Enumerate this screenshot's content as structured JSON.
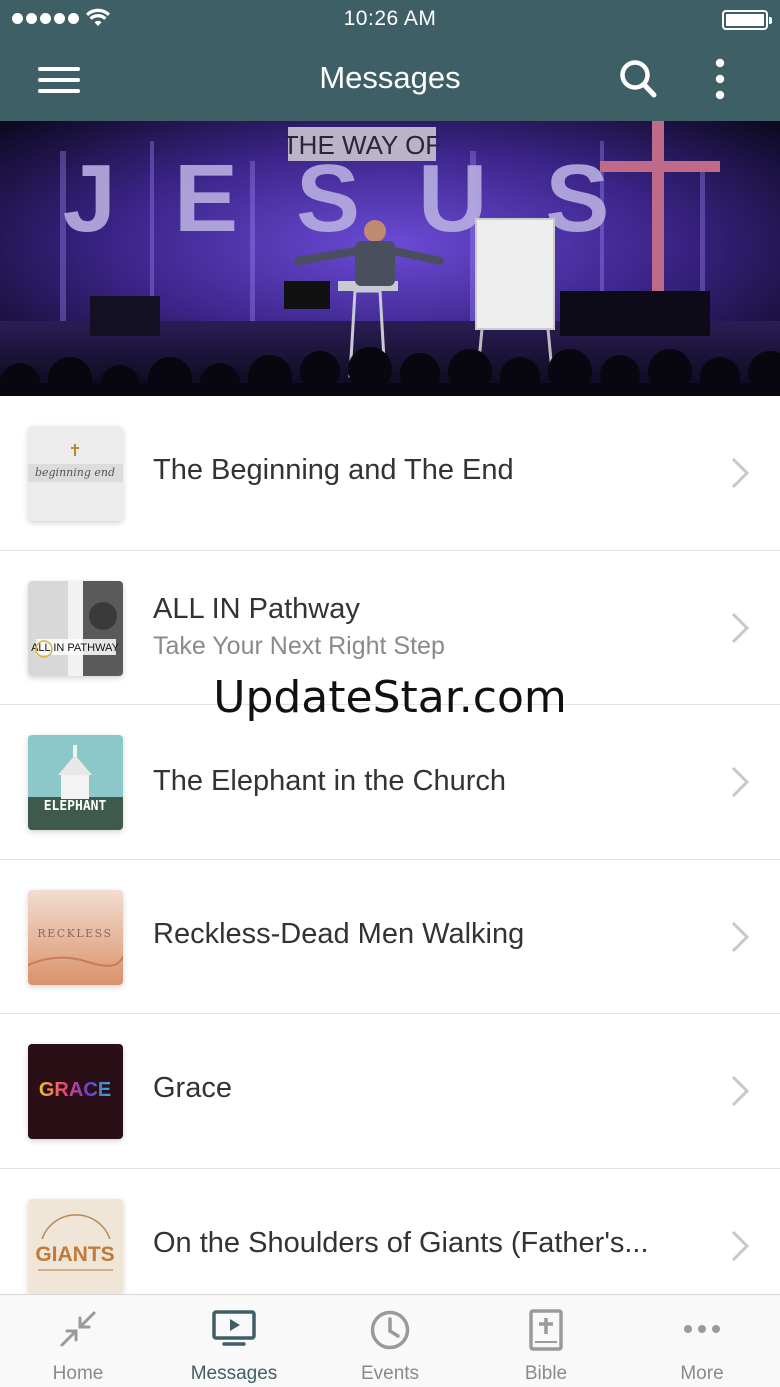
{
  "status_bar": {
    "time": "10:26 AM"
  },
  "navbar": {
    "title": "Messages"
  },
  "messages": [
    {
      "title": "The Beginning and The End",
      "subtitle": "",
      "thumb_text": "beginning end"
    },
    {
      "title": "ALL IN Pathway",
      "subtitle": "Take Your Next Right Step",
      "thumb_text": "ALL IN PATHWAY"
    },
    {
      "title": "The Elephant in the Church",
      "subtitle": "",
      "thumb_text": "ELEPHANT"
    },
    {
      "title": "Reckless-Dead Men Walking",
      "subtitle": "",
      "thumb_text": "RECKLESS"
    },
    {
      "title": "Grace",
      "subtitle": "",
      "thumb_text": "GRACE"
    },
    {
      "title": "On the Shoulders of Giants (Father's...",
      "subtitle": "",
      "thumb_text": "GIANTS"
    }
  ],
  "watermark": "UpdateStar.com",
  "hero": {
    "banner_top": "THE WAY OF",
    "banner_main": "JESUS"
  },
  "tabs": [
    {
      "label": "Home",
      "icon": "collapse-arrows-icon"
    },
    {
      "label": "Messages",
      "icon": "tv-play-icon",
      "active": true
    },
    {
      "label": "Events",
      "icon": "clock-icon"
    },
    {
      "label": "Bible",
      "icon": "bible-icon"
    },
    {
      "label": "More",
      "icon": "ellipsis-icon"
    }
  ],
  "colors": {
    "header": "#3f5f66",
    "active_tab": "#3f5f66",
    "inactive_tab": "#8a8a8a"
  }
}
